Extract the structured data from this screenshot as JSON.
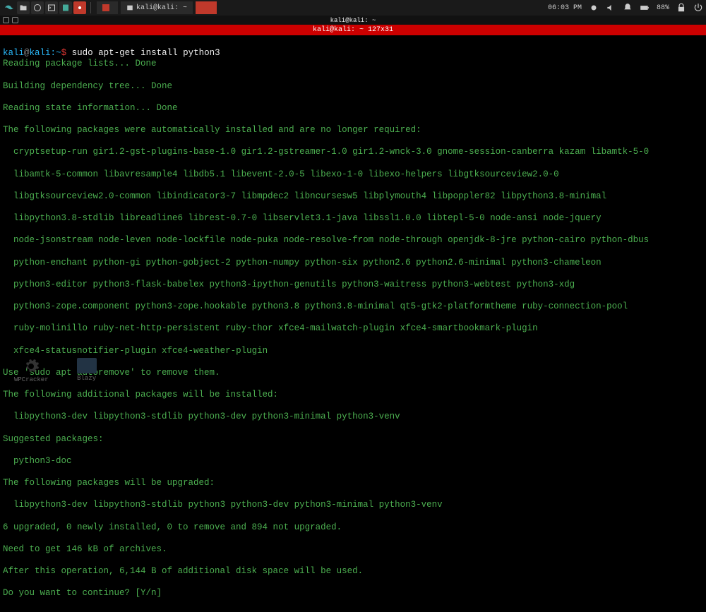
{
  "taskbar": {
    "task1_label": "",
    "task2_label": "kali@kali: ~",
    "clock": "06:03 PM",
    "battery": "88%"
  },
  "window": {
    "mini_title": "kali@kali: ~",
    "red_title": "kali@kali: ~ 127x31"
  },
  "prompt": {
    "user": "kali",
    "at": "@",
    "host": "kali",
    "colon": ":",
    "path": "~",
    "dollar": "$ ",
    "command": "sudo apt-get install python3"
  },
  "lines": {
    "l1": "Reading package lists... Done",
    "l2": "Building dependency tree... Done",
    "l3": "Reading state information... Done",
    "l4": "The following packages were automatically installed and are no longer required:",
    "l5": "  cryptsetup-run gir1.2-gst-plugins-base-1.0 gir1.2-gstreamer-1.0 gir1.2-wnck-3.0 gnome-session-canberra kazam libamtk-5-0",
    "l6": "  libamtk-5-common libavresample4 libdb5.1 libevent-2.0-5 libexo-1-0 libexo-helpers libgtksourceview2.0-0",
    "l7": "  libgtksourceview2.0-common libindicator3-7 libmpdec2 libncursesw5 libplymouth4 libpoppler82 libpython3.8-minimal",
    "l8": "  libpython3.8-stdlib libreadline6 librest-0.7-0 libservlet3.1-java libssl1.0.0 libtepl-5-0 node-ansi node-jquery",
    "l9": "  node-jsonstream node-leven node-lockfile node-puka node-resolve-from node-through openjdk-8-jre python-cairo python-dbus",
    "l10": "  python-enchant python-gi python-gobject-2 python-numpy python-six python2.6 python2.6-minimal python3-chameleon",
    "l11": "  python3-editor python3-flask-babelex python3-ipython-genutils python3-waitress python3-webtest python3-xdg",
    "l12": "  python3-zope.component python3-zope.hookable python3.8 python3.8-minimal qt5-gtk2-platformtheme ruby-connection-pool",
    "l13": "  ruby-molinillo ruby-net-http-persistent ruby-thor xfce4-mailwatch-plugin xfce4-smartbookmark-plugin",
    "l14": "  xfce4-statusnotifier-plugin xfce4-weather-plugin",
    "l15": "Use 'sudo apt autoremove' to remove them.",
    "l16": "The following additional packages will be installed:",
    "l17": "  libpython3-dev libpython3-stdlib python3-dev python3-minimal python3-venv",
    "l18": "Suggested packages:",
    "l19": "  python3-doc",
    "l20": "The following packages will be upgraded:",
    "l21": "  libpython3-dev libpython3-stdlib python3 python3-dev python3-minimal python3-venv",
    "l22": "6 upgraded, 0 newly installed, 0 to remove and 894 not upgraded.",
    "l23": "Need to get 146 kB of archives.",
    "l24": "After this operation, 6,144 B of additional disk space will be used.",
    "l25": "Do you want to continue? [Y/n]"
  },
  "desktop": {
    "icon1": "WPCracker",
    "icon2": "Blazy"
  }
}
